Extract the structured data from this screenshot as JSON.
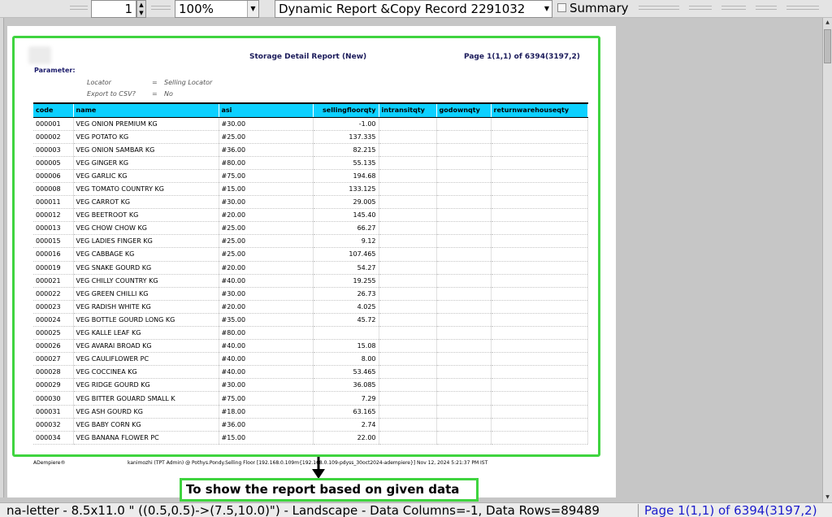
{
  "toolbar": {
    "page_number": "1",
    "zoom": "100%",
    "report_name": "Dynamic Report &Copy Record 2291032",
    "summary_label": "Summary"
  },
  "report": {
    "title": "Storage Detail Report (New)",
    "page_info": "Page 1(1,1) of 6394(3197,2)",
    "parameter_heading": "Parameter:",
    "parameters": [
      {
        "name": "Locator",
        "eq": "=",
        "value": "Selling Locator"
      },
      {
        "name": "Export to CSV?",
        "eq": "=",
        "value": "No"
      }
    ],
    "columns": [
      "code",
      "name",
      "asi",
      "sellingfloorqty",
      "intransitqty",
      "godownqty",
      "returnwarehouseqty"
    ],
    "rows": [
      [
        "000001",
        "VEG ONION PREMIUM KG",
        "#30.00",
        "-1.00",
        "",
        "",
        ""
      ],
      [
        "000002",
        "VEG POTATO KG",
        "#25.00",
        "137.335",
        "",
        "",
        ""
      ],
      [
        "000003",
        "VEG ONION SAMBAR KG",
        "#36.00",
        "82.215",
        "",
        "",
        ""
      ],
      [
        "000005",
        "VEG GINGER KG",
        "#80.00",
        "55.135",
        "",
        "",
        ""
      ],
      [
        "000006",
        "VEG GARLIC KG",
        "#75.00",
        "194.68",
        "",
        "",
        ""
      ],
      [
        "000008",
        "VEG TOMATO COUNTRY KG",
        "#15.00",
        "133.125",
        "",
        "",
        ""
      ],
      [
        "000011",
        "VEG CARROT KG",
        "#30.00",
        "29.005",
        "",
        "",
        ""
      ],
      [
        "000012",
        "VEG BEETROOT KG",
        "#20.00",
        "145.40",
        "",
        "",
        ""
      ],
      [
        "000013",
        "VEG CHOW CHOW KG",
        "#25.00",
        "66.27",
        "",
        "",
        ""
      ],
      [
        "000015",
        "VEG LADIES FINGER KG",
        "#25.00",
        "9.12",
        "",
        "",
        ""
      ],
      [
        "000016",
        "VEG CABBAGE KG",
        "#25.00",
        "107.465",
        "",
        "",
        ""
      ],
      [
        "000019",
        "VEG SNAKE GOURD KG",
        "#20.00",
        "54.27",
        "",
        "",
        ""
      ],
      [
        "000021",
        "VEG CHILLY COUNTRY KG",
        "#40.00",
        "19.255",
        "",
        "",
        ""
      ],
      [
        "000022",
        "VEG GREEN CHILLI KG",
        "#30.00",
        "26.73",
        "",
        "",
        ""
      ],
      [
        "000023",
        "VEG RADISH WHITE KG",
        "#20.00",
        "4.025",
        "",
        "",
        ""
      ],
      [
        "000024",
        "VEG BOTTLE GOURD LONG KG",
        "#35.00",
        "45.72",
        "",
        "",
        ""
      ],
      [
        "000025",
        "VEG KALLE LEAF KG",
        "#80.00",
        "",
        "",
        "",
        ""
      ],
      [
        "000026",
        "VEG AVARAI BROAD KG",
        "#40.00",
        "15.08",
        "",
        "",
        ""
      ],
      [
        "000027",
        "VEG CAULIFLOWER PC",
        "#40.00",
        "8.00",
        "",
        "",
        ""
      ],
      [
        "000028",
        "VEG COCCINEA KG",
        "#40.00",
        "53.465",
        "",
        "",
        ""
      ],
      [
        "000029",
        "VEG RIDGE GOURD KG",
        "#30.00",
        "36.085",
        "",
        "",
        ""
      ],
      [
        "000030",
        "VEG BITTER GOUARD SMALL K",
        "#75.00",
        "7.29",
        "",
        "",
        ""
      ],
      [
        "000031",
        "VEG ASH GOURD KG",
        "#18.00",
        "63.165",
        "",
        "",
        ""
      ],
      [
        "000032",
        "VEG BABY CORN KG",
        "#36.00",
        "2.74",
        "",
        "",
        ""
      ],
      [
        "000034",
        "VEG BANANA FLOWER PC",
        "#15.00",
        "22.00",
        "",
        "",
        ""
      ]
    ],
    "footer_left": "ADempiere®",
    "footer_right": "kanimozhi (TPT Admin) @ Pothys.Pondy.Selling Floor [192.168.0.109m{192.168.0.109-pdyss_30oct2024-adempiere}] Nov 12, 2024 5:21:37 PM IST"
  },
  "annotation": {
    "text": "To show the report based on given data"
  },
  "statusbar": {
    "info": "na-letter - 8.5x11.0 \" ((0.5,0.5)->(7.5,10.0)\") - Landscape - Data Columns=-1, Data Rows=89489",
    "page": "Page 1(1,1) of 6394(3197,2)"
  },
  "colors": {
    "header_bg": "#0cd0ff",
    "highlight": "#3fd43f",
    "status_page": "#1c1ccc"
  }
}
